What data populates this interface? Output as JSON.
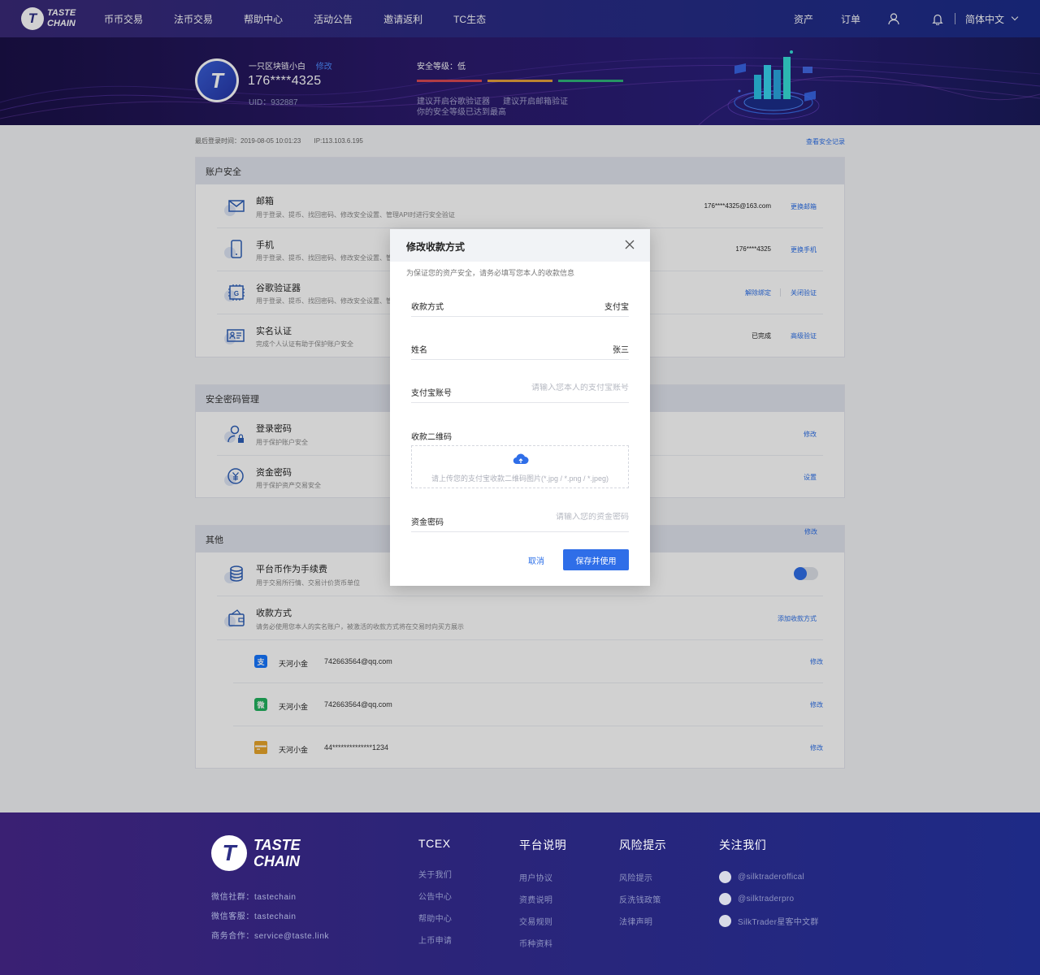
{
  "nav": {
    "logo_line1": "TASTE",
    "logo_line2": "CHAIN",
    "links": [
      "币币交易",
      "法币交易",
      "帮助中心",
      "活动公告",
      "邀请返利",
      "TC生态"
    ],
    "assets": "资产",
    "orders": "订单",
    "language": "简体中文"
  },
  "profile": {
    "nickname": "一只区块链小白",
    "edit": "修改",
    "phone": "176****4325",
    "uid": "UID：932887",
    "security_level": "安全等级：低",
    "tip1": "建议开启谷歌验证器",
    "tip2": "建议开启邮箱验证",
    "tip3": "你的安全等级已达到最高",
    "bar_colors": [
      "#d94a54",
      "#e6a23c",
      "#2fb57a"
    ]
  },
  "meta": {
    "last_login": "最后登录时间：2019-08-05 10:01:23",
    "ip": "IP:113.103.6.195",
    "security_log": "查看安全记录"
  },
  "account_security": {
    "title": "账户安全",
    "email": {
      "title": "邮箱",
      "desc": "用于登录、提币、找回密码、修改安全设置、管理API时进行安全验证",
      "value": "176****4325@163.com",
      "action": "更换邮箱"
    },
    "phone": {
      "title": "手机",
      "desc": "用于登录、提币、找回密码、修改安全设置、管",
      "value": "176****4325",
      "action": "更换手机"
    },
    "google": {
      "title": "谷歌验证器",
      "desc": "用于登录、提币、找回密码、修改安全设置、管",
      "action1": "解除绑定",
      "action2": "关闭验证"
    },
    "realname": {
      "title": "实名认证",
      "desc": "完成个人认证有助于保护账户安全",
      "status": "已完成",
      "action": "高级验证"
    }
  },
  "password_mgmt": {
    "title": "安全密码管理",
    "login": {
      "title": "登录密码",
      "desc": "用于保护账户安全",
      "action": "修改"
    },
    "fund": {
      "title": "资金密码",
      "desc": "用于保护资产交易安全",
      "action": "设置"
    }
  },
  "other": {
    "title": "其他",
    "edit_top": "修改",
    "fee": {
      "title": "平台币作为手续费",
      "desc": "用于交易所行情、交易计价货币单位"
    },
    "payment": {
      "title": "收款方式",
      "desc": "请务必使用您本人的实名账户，被激活的收款方式将在交易时向买方展示",
      "action": "添加收款方式"
    },
    "methods": [
      {
        "icon": "alipay-icon",
        "name": "天河小金",
        "account": "742663564@qq.com",
        "action": "修改",
        "color": "#1677ff"
      },
      {
        "icon": "wechat-icon",
        "name": "天河小金",
        "account": "742663564@qq.com",
        "action": "修改",
        "color": "#22b35e"
      },
      {
        "icon": "bank-card-icon",
        "name": "天河小金",
        "account": "44**************1234",
        "action": "修改",
        "color": "#e8a52a"
      }
    ]
  },
  "modal": {
    "title": "修改收款方式",
    "subtitle": "为保证您的资产安全，请务必填写您本人的收款信息",
    "method_label": "收款方式",
    "method_value": "支付宝",
    "name_label": "姓名",
    "name_value": "张三",
    "account_label": "支付宝账号",
    "account_placeholder": "请输入您本人的支付宝账号",
    "qr_label": "收款二维码",
    "upload_text": "请上传您的支付宝收款二维码图片(*.jpg / *.png / *.jpeg)",
    "fund_pwd_label": "资金密码",
    "fund_pwd_placeholder": "请输入您的资金密码",
    "cancel": "取消",
    "save": "保存并使用"
  },
  "footer": {
    "logo_line1": "TASTE",
    "logo_line2": "CHAIN",
    "wechat_group": "微信社群：tastechain",
    "wechat_service": "微信客服：tastechain",
    "business": "商务合作：service@taste.link",
    "columns": [
      {
        "title": "TCEX",
        "items": [
          "关于我们",
          "公告中心",
          "帮助中心",
          "上币申请"
        ]
      },
      {
        "title": "平台说明",
        "items": [
          "用户协议",
          "资费说明",
          "交易规则",
          "币种资料"
        ]
      },
      {
        "title": "风险提示",
        "items": [
          "风险提示",
          "反洗钱政策",
          "法律声明"
        ]
      },
      {
        "title": "关注我们",
        "items": [
          "@silktraderoffical",
          "@silktraderpro",
          "SilkTrader星客中文群"
        ]
      }
    ]
  }
}
